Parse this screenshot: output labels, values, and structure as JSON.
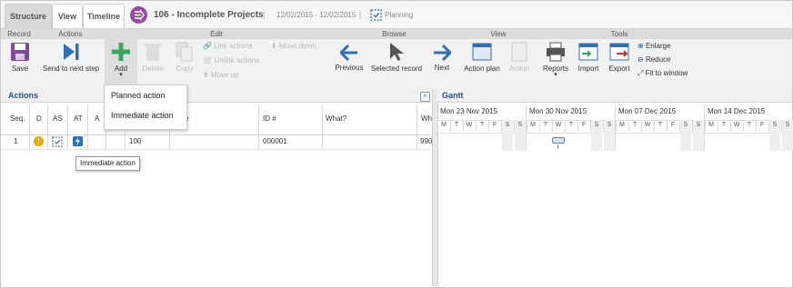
{
  "tabs": [
    {
      "label": "Structure"
    },
    {
      "label": "View"
    },
    {
      "label": "Timeline"
    }
  ],
  "project": {
    "title": "106 - Incomplete Projects",
    "dates": "12/02/2015 - 12/02/2015",
    "status": "Planning"
  },
  "ribbon": {
    "groups": [
      "Record",
      "Actions",
      "Edit",
      "Browse",
      "View",
      "Tools"
    ],
    "save": "Save",
    "send_next": "Send to next step",
    "add": "Add",
    "delete": "Delete",
    "copy": "Copy",
    "link_actions": "Link actions",
    "unlink_actions": "Unlink actions",
    "move_up": "Move up",
    "move_down": "Move down",
    "previous": "Previous",
    "selected_record": "Selected record",
    "next": "Next",
    "action_plan": "Action plan",
    "action": "Action",
    "reports": "Reports",
    "import": "Import",
    "export": "Export",
    "enlarge": "Enlarge",
    "reduce": "Reduce",
    "fit_to_window": "Fit to window"
  },
  "add_menu": {
    "items": [
      "Planned action",
      "Immediate action"
    ]
  },
  "actions_panel": {
    "title": "Actions",
    "columns": [
      "Seq.",
      "D",
      "AS",
      "AT",
      "A",
      "e",
      "ID #",
      "What?",
      "Wh"
    ],
    "rows": [
      {
        "seq": "1",
        "code": "100",
        "id": "000001",
        "wh": "990"
      }
    ],
    "tooltip": "Immediate action"
  },
  "gantt": {
    "title": "Gantt",
    "weeks": [
      "Mon 23 Nov 2015",
      "Mon 30 Nov 2015",
      "Mon 07 Dec 2015",
      "Mon 14 Dec 2015"
    ],
    "day_letters": [
      "M",
      "T",
      "W",
      "T",
      "F",
      "S",
      "S"
    ]
  },
  "colors": {
    "accent": "#24568a",
    "project_icon": "#9b4b9b",
    "add_green": "#3aa55c",
    "warning": "#f0a800"
  }
}
